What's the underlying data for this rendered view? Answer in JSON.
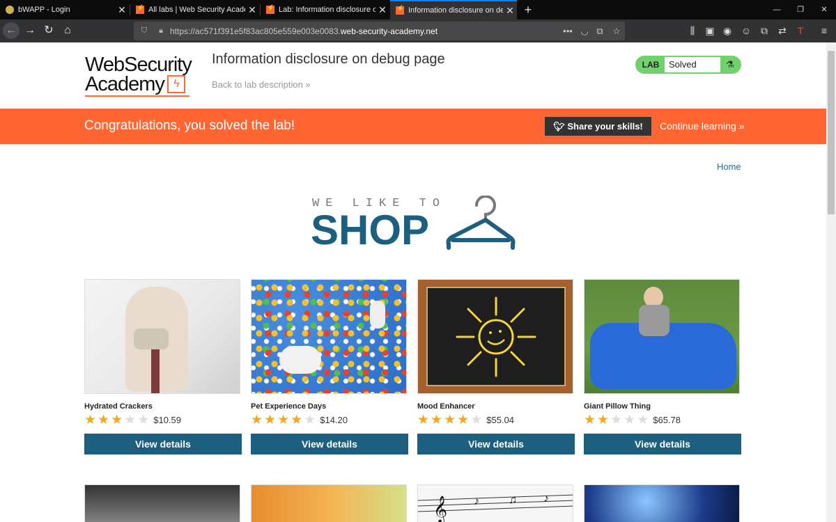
{
  "browser": {
    "tabs": [
      {
        "title": "bWAPP - Login",
        "icon": "bwapp-favicon"
      },
      {
        "title": "All labs | Web Security Academy",
        "icon": "portswigger-favicon"
      },
      {
        "title": "Lab: Information disclosure on debug page",
        "icon": "portswigger-favicon"
      },
      {
        "title": "Information disclosure on debug page",
        "icon": "portswigger-favicon"
      }
    ],
    "url_prefix": "https://ac571f391e5f83ac805e559e003e0083.",
    "url_domain": "web-security-academy.net"
  },
  "header": {
    "logo_line1": "WebSecurity",
    "logo_line2": "Academy",
    "lab_title": "Information disclosure on debug page",
    "back_link": "Back to lab description",
    "lab_badge": "LAB",
    "lab_status": "Solved"
  },
  "banner": {
    "message": "Congratulations, you solved the lab!",
    "share_button": "Share your skills!",
    "continue_link": "Continue learning"
  },
  "nav": {
    "home": "Home"
  },
  "shop_logo": {
    "tagline": "WE LIKE TO",
    "word": "SHOP"
  },
  "products": [
    {
      "name": "Hydrated Crackers",
      "rating": 3,
      "price": "$10.59",
      "button": "View details"
    },
    {
      "name": "Pet Experience Days",
      "rating": 4,
      "price": "$14.20",
      "button": "View details"
    },
    {
      "name": "Mood Enhancer",
      "rating": 4,
      "price": "$55.04",
      "button": "View details"
    },
    {
      "name": "Giant Pillow Thing",
      "rating": 2,
      "price": "$65.78",
      "button": "View details"
    }
  ],
  "colors": {
    "accent": "#ff6633",
    "shop_blue": "#1d5f7e",
    "solved_green": "#70d16d",
    "star": "#f3a91f"
  }
}
